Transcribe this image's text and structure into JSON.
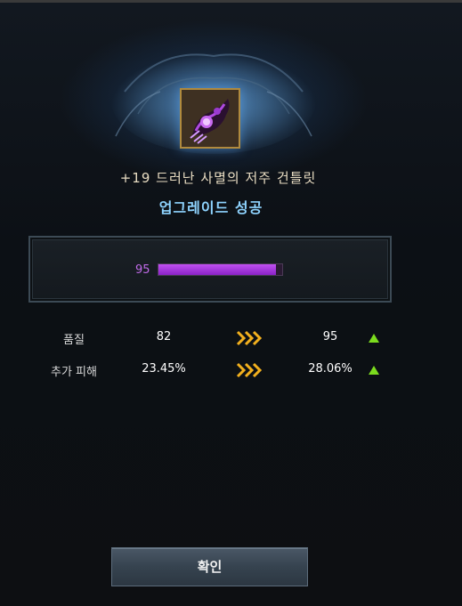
{
  "item": {
    "name": "+19 드러난 사멸의 저주 건틀릿",
    "icon": "gauntlet-icon"
  },
  "result": {
    "title": "업그레이드 성공"
  },
  "quality_gauge": {
    "value": "95",
    "fill_fraction": 0.95,
    "color": "#b040e8"
  },
  "stats": [
    {
      "label": "품질",
      "before": "82",
      "after": "95",
      "change": "up"
    },
    {
      "label": "추가 피해",
      "before": "23.45%",
      "after": "28.06%",
      "change": "up"
    }
  ],
  "colors": {
    "arrow": "#f2b01e",
    "up_indicator": "#7cdc1e",
    "title": "#8fd4ff"
  },
  "buttons": {
    "confirm_label": "확인"
  }
}
